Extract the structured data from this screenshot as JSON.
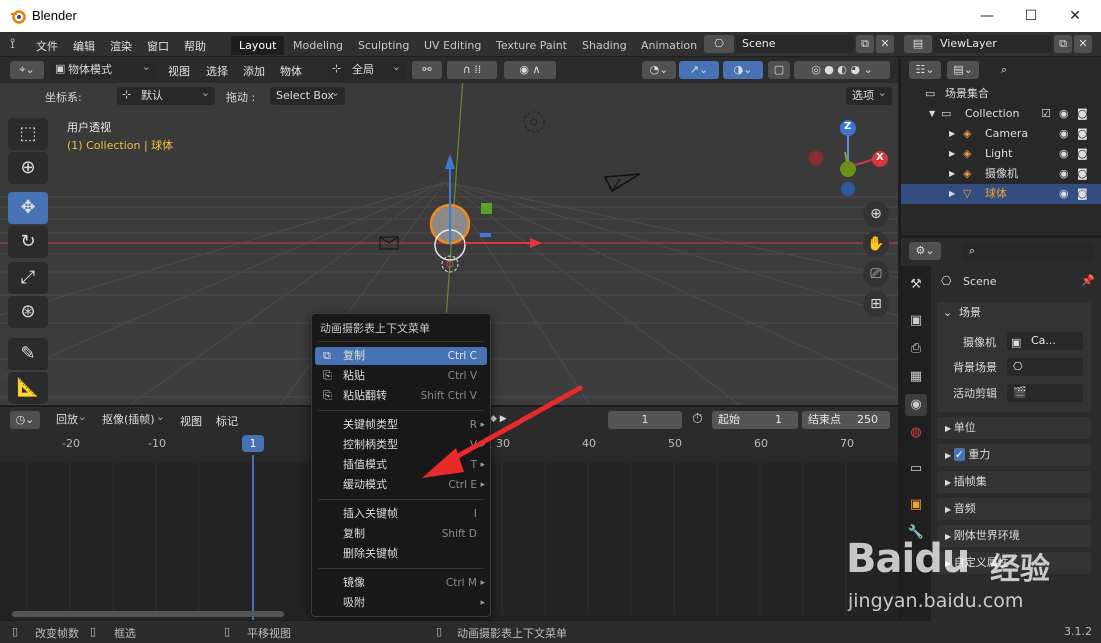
{
  "window": {
    "title": "Blender",
    "minimize": "—",
    "maximize": "☐",
    "close": "✕"
  },
  "menu": {
    "items": [
      "文件",
      "编辑",
      "渲染",
      "窗口",
      "帮助"
    ]
  },
  "workspaces": [
    "Layout",
    "Modeling",
    "Sculpting",
    "UV Editing",
    "Texture Paint",
    "Shading",
    "Animation"
  ],
  "scene": {
    "name": "Scene"
  },
  "viewlayer": {
    "name": "ViewLayer"
  },
  "viewport": {
    "mode": "物体模式",
    "menus": [
      "视图",
      "选择",
      "添加",
      "物体"
    ],
    "orientation": "全局",
    "coord_label": "坐标系:",
    "coord_value": "默认",
    "drag_label": "拖动 :",
    "drag_value": "Select Box",
    "options": "选项",
    "view_name": "用户透视",
    "collection_info": "(1) Collection | 球体",
    "axes": {
      "z": "Z",
      "x": "X"
    }
  },
  "timeline": {
    "menus": [
      "回放",
      "抠像(插帧)",
      "视图",
      "标记"
    ],
    "current_frame": "1",
    "start_label": "起始",
    "start_value": "1",
    "end_label": "结束点",
    "end_value": "250",
    "ticks": [
      "-20",
      "-10",
      "1",
      "30",
      "40",
      "50",
      "60",
      "70"
    ]
  },
  "context_menu": {
    "title": "动画摄影表上下文菜单",
    "items": [
      {
        "label": "复制",
        "shortcut": "Ctrl C",
        "highlighted": true
      },
      {
        "label": "粘贴",
        "shortcut": "Ctrl V"
      },
      {
        "label": "粘贴翻转",
        "shortcut": "Shift Ctrl V"
      },
      {
        "label": "关键帧类型",
        "shortcut": "R"
      },
      {
        "label": "控制柄类型",
        "shortcut": "V"
      },
      {
        "label": "插值模式",
        "shortcut": "T"
      },
      {
        "label": "缓动模式",
        "shortcut": "Ctrl E"
      },
      {
        "label": "插入关键帧",
        "shortcut": "I"
      },
      {
        "label": "复制",
        "shortcut": "Shift D"
      },
      {
        "label": "删除关键帧",
        "shortcut": ""
      },
      {
        "label": "镜像",
        "shortcut": "Ctrl M"
      },
      {
        "label": "吸附",
        "shortcut": ""
      }
    ]
  },
  "outliner": {
    "root": "场景集合",
    "items": [
      "Collection",
      "Camera",
      "Light",
      "摄像机",
      "球体"
    ]
  },
  "properties": {
    "header": "Scene",
    "section_scene": "场景",
    "camera_label": "摄像机",
    "camera_value": "Ca...",
    "background_label": "背景场景",
    "active_clip_label": "活动剪辑",
    "panels": [
      "单位",
      "重力",
      "插帧集",
      "音频",
      "刚体世界环境",
      "自定义属性"
    ]
  },
  "status": {
    "items": [
      "改变帧数",
      "框选",
      "平移视图",
      "动画摄影表上下文菜单"
    ],
    "version": "3.1.2"
  },
  "watermark": {
    "brand": "Baidu",
    "text": "经验",
    "url": "jingyan.baidu.com"
  },
  "colors": {
    "accent": "#4772b3",
    "timeline_cursor": "#4772b3",
    "annotation_arrow": "#e82a2a",
    "x_axis": "#d2393c",
    "selection": "#334d80"
  }
}
